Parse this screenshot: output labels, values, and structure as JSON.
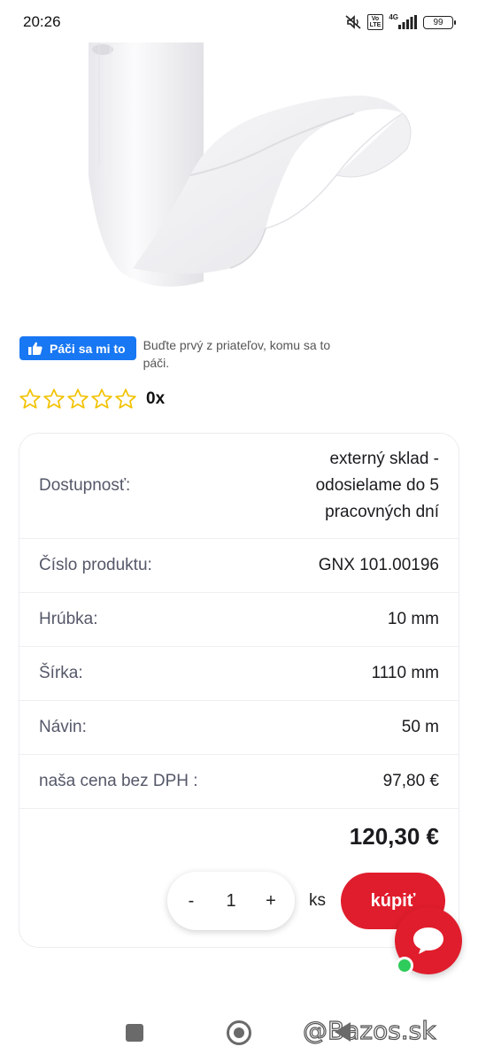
{
  "status_bar": {
    "time": "20:26",
    "network": "4G",
    "volte": "Vo LTE",
    "battery": "99"
  },
  "facebook": {
    "like_label": "Páči sa mi to",
    "like_text": "Buďte prvý z priateľov, komu sa to páči."
  },
  "rating": {
    "stars_filled": 0,
    "stars_total": 5,
    "count": "0x"
  },
  "details": {
    "availability_label": "Dostupnosť:",
    "availability_value": "externý sklad - odosielame do 5 pracovných dní",
    "product_number_label": "Číslo produktu:",
    "product_number_value": "GNX 101.00196",
    "thickness_label": "Hrúbka:",
    "thickness_value": "10 mm",
    "width_label": "Šírka:",
    "width_value": "1110 mm",
    "roll_label": "Návin:",
    "roll_value": "50 m",
    "price_label": "naša cena bez DPH :",
    "price_value": "97,80 €",
    "total_price": "120,30 €"
  },
  "cart": {
    "minus": "-",
    "quantity": "1",
    "plus": "+",
    "unit": "ks",
    "buy_label": "kúpiť"
  },
  "watermark": "@Bazos.sk",
  "colors": {
    "accent": "#e01d2c",
    "facebook": "#1877f2",
    "star_outline": "#f2c200",
    "online": "#2ecc5a"
  }
}
